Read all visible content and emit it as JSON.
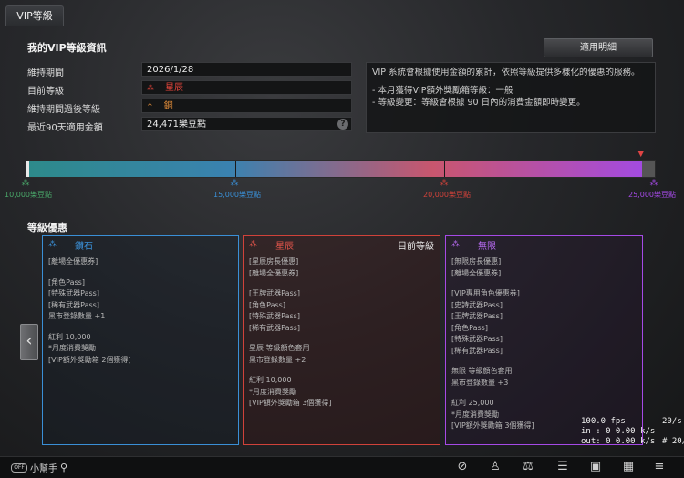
{
  "tab": {
    "label": "VIP等級"
  },
  "section": {
    "title": "我的VIP等級資訊",
    "detail_button": "適用明細"
  },
  "rows": [
    {
      "label": "維持期間",
      "value": "2026/1/28"
    },
    {
      "label": "目前等級",
      "value": "星辰"
    },
    {
      "label": "維持期間過後等級",
      "value": "銅"
    },
    {
      "label": "最近90天適用金額",
      "value": "24,471樂豆點"
    }
  ],
  "info": {
    "line1": "VIP 系統會根據使用金額的累計，依照等級提供多樣化的優惠的服務。",
    "line2": "- 本月獲得VIP額外獎勵箱等級：一般",
    "line3": "- 等級變更：等級會根據 90 日內的消費金額即時變更。"
  },
  "progress": {
    "fraction": 0.98,
    "tiers": [
      "10,000樂豆點",
      "15,000樂豆點",
      "20,000樂豆點",
      "25,000樂豆點"
    ]
  },
  "benefits": {
    "title": "等級優惠"
  },
  "cards": {
    "diamond": {
      "name": "鑽石",
      "lines": [
        "[離場全優惠券]",
        "",
        "[角色Pass]",
        "[特殊武器Pass]",
        "[稀有武器Pass]",
        "黑市登錄數量 +1",
        "",
        "紅利 10,000",
        "*月度消費獎勵",
        "[VIP額外獎勵箱 2個獲得]"
      ]
    },
    "star": {
      "name": "星辰",
      "current": "目前等級",
      "lines": [
        "[星辰房長優惠]",
        "[離場全優惠券]",
        "",
        "[王牌武器Pass]",
        "[角色Pass]",
        "[特殊武器Pass]",
        "[稀有武器Pass]",
        "",
        "星辰 等級顏色套用",
        "黑市登錄數量 +2",
        "",
        "紅利 10,000",
        "*月度消費獎勵",
        "[VIP額外獎勵箱 3個獲得]"
      ]
    },
    "infinite": {
      "name": "無限",
      "lines": [
        "[無限房長優惠]",
        "[離場全優惠券]",
        "",
        "[VIP專用角色優惠券]",
        "[史詩武器Pass]",
        "[王牌武器Pass]",
        "[角色Pass]",
        "[特殊武器Pass]",
        "[稀有武器Pass]",
        "",
        "無限 等級顏色套用",
        "黑市登錄數量 +3",
        "",
        "紅利 25,000",
        "*月度消費獎勵",
        "[VIP額外獎勵箱 3個獲得]"
      ]
    }
  },
  "stats": {
    "fps": "100.0 fps",
    "in": "in : 0 0.00 k/s",
    "out": "out: 0 0.00 k/s",
    "right1": "20/s",
    "right2": "# 20/s"
  },
  "bottom": {
    "helper": "小幫手",
    "pill": "OFF"
  },
  "colors": {
    "diamond": "#3a8fd6",
    "star": "#d0423a",
    "infinite": "#a54ae6"
  }
}
